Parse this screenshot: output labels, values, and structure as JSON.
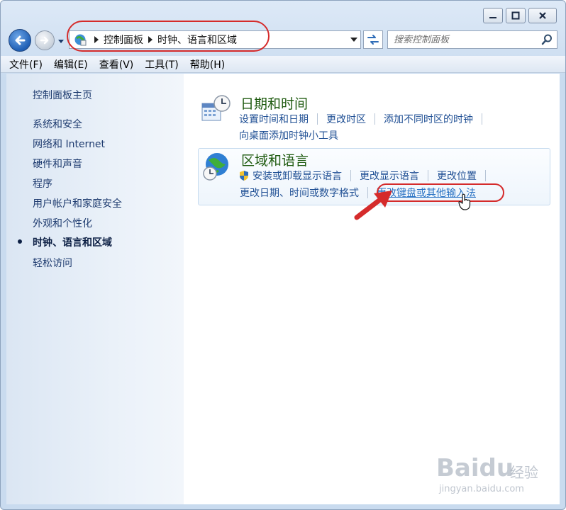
{
  "breadcrumb": {
    "items": [
      "控制面板",
      "时钟、语言和区域"
    ]
  },
  "search": {
    "placeholder": "搜索控制面板"
  },
  "menu": {
    "items": [
      "文件(F)",
      "编辑(E)",
      "查看(V)",
      "工具(T)",
      "帮助(H)"
    ]
  },
  "sidebar": {
    "items": [
      "控制面板主页",
      "系统和安全",
      "网络和 Internet",
      "硬件和声音",
      "程序",
      "用户帐户和家庭安全",
      "外观和个性化",
      "时钟、语言和区域",
      "轻松访问"
    ],
    "current_index": 7
  },
  "categories": {
    "datetime": {
      "title": "日期和时间",
      "links": [
        "设置时间和日期",
        "更改时区",
        "添加不同时区的时钟",
        "向桌面添加时钟小工具"
      ]
    },
    "region": {
      "title": "区域和语言",
      "links": [
        "安装或卸载显示语言",
        "更改显示语言",
        "更改位置",
        "更改日期、时间或数字格式",
        "更改键盘或其他输入法"
      ]
    }
  },
  "colors": {
    "annotation": "#d52b2b",
    "category_title": "#1e5a0f",
    "link": "#1f4f94"
  },
  "watermark": {
    "brand": "Baidu",
    "cn": "经验",
    "url": "jingyan.baidu.com"
  }
}
